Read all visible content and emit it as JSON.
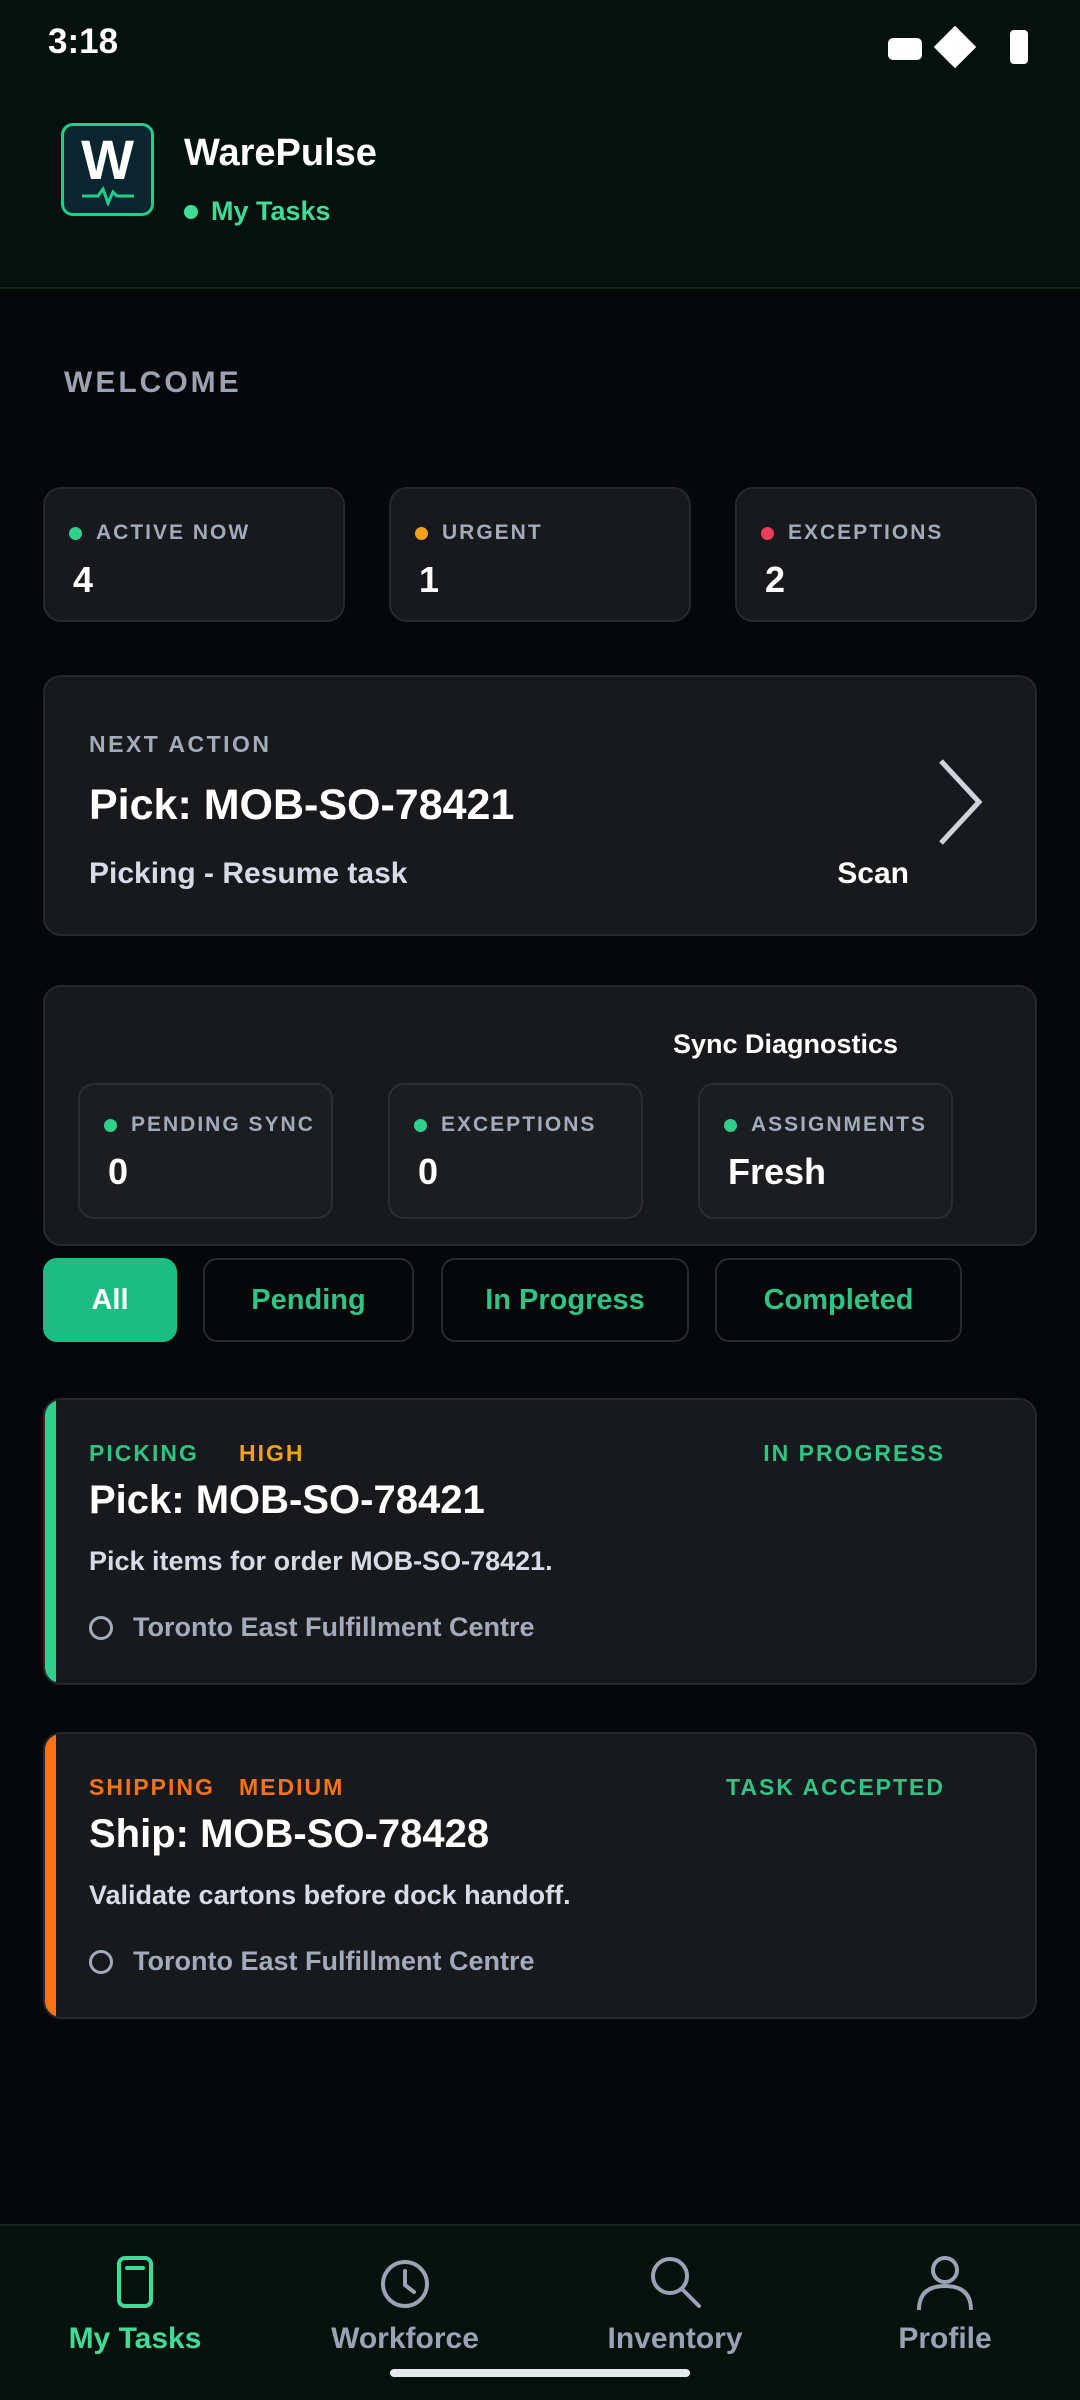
{
  "status_bar": {
    "time": "3:18"
  },
  "header": {
    "app_name": "WarePulse",
    "subtitle": "My Tasks",
    "logo_letter": "W"
  },
  "welcome": "WELCOME",
  "stats": [
    {
      "label": "ACTIVE NOW",
      "value": "4",
      "color": "#2fd08c"
    },
    {
      "label": "URGENT",
      "value": "1",
      "color": "#f2a11b"
    },
    {
      "label": "EXCEPTIONS",
      "value": "2",
      "color": "#ee3d58"
    }
  ],
  "next_action": {
    "label": "NEXT ACTION",
    "title": "Pick: MOB-SO-78421",
    "subtitle": "Picking - Resume task",
    "action": "Scan"
  },
  "sync": {
    "title": "Sync Diagnostics",
    "items": [
      {
        "label": "PENDING SYNC",
        "value": "0"
      },
      {
        "label": "EXCEPTIONS",
        "value": "0"
      },
      {
        "label": "ASSIGNMENTS",
        "value": "Fresh"
      }
    ]
  },
  "filters": [
    {
      "label": "All",
      "active": true
    },
    {
      "label": "Pending",
      "active": false
    },
    {
      "label": "In Progress",
      "active": false
    },
    {
      "label": "Completed",
      "active": false
    }
  ],
  "tasks": [
    {
      "type": "PICKING",
      "priority": "HIGH",
      "status": "IN PROGRESS",
      "title": "Pick: MOB-SO-78421",
      "description": "Pick items for order MOB-SO-78421.",
      "location": "Toronto East Fulfillment Centre",
      "accent": "#2fd08c",
      "type_color": "#2fc486",
      "priority_color": "#f2a11b",
      "status_color": "#2fc486"
    },
    {
      "type": "SHIPPING",
      "priority": "MEDIUM",
      "status": "TASK ACCEPTED",
      "title": "Ship: MOB-SO-78428",
      "description": "Validate cartons before dock handoff.",
      "location": "Toronto East Fulfillment Centre",
      "accent": "#f97316",
      "type_color": "#f97316",
      "priority_color": "#f97316",
      "status_color": "#2fc486"
    }
  ],
  "nav": [
    {
      "label": "My Tasks",
      "icon": "clipboard-icon",
      "active": true
    },
    {
      "label": "Workforce",
      "icon": "clock-icon",
      "active": false
    },
    {
      "label": "Inventory",
      "icon": "search-icon",
      "active": false
    },
    {
      "label": "Profile",
      "icon": "person-icon",
      "active": false
    }
  ]
}
